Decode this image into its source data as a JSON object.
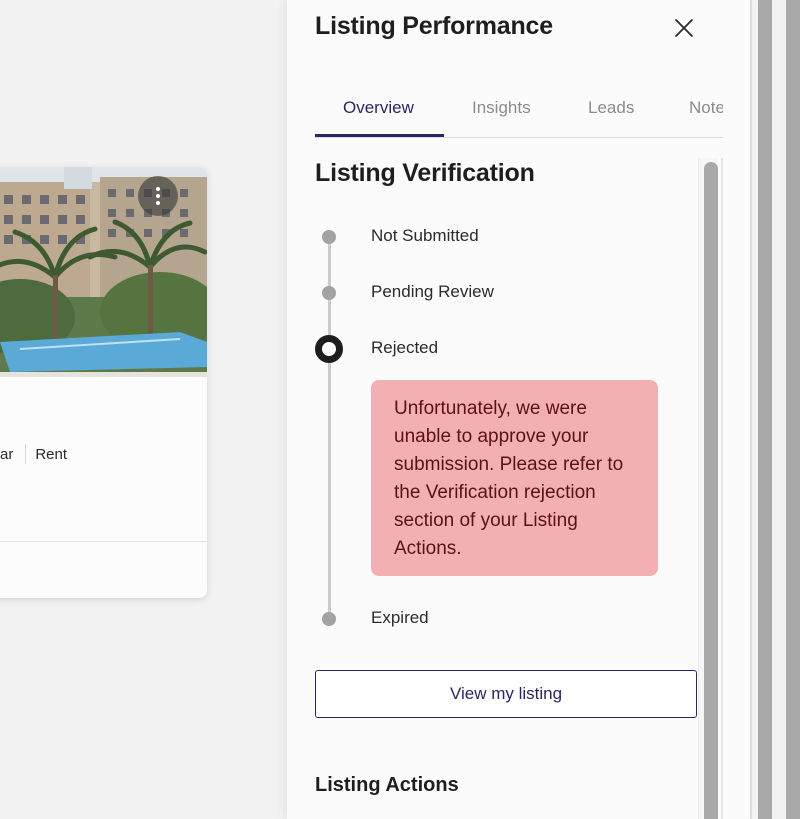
{
  "background_card": {
    "meta_tags": [
      "ar",
      "Rent"
    ]
  },
  "panel": {
    "title": "Listing Performance",
    "tabs": [
      {
        "label": "Overview",
        "active": true
      },
      {
        "label": "Insights",
        "active": false
      },
      {
        "label": "Leads",
        "active": false
      },
      {
        "label": "Note",
        "active": false
      }
    ]
  },
  "verification": {
    "title": "Listing Verification",
    "steps": [
      {
        "label": "Not Submitted",
        "state": "inactive"
      },
      {
        "label": "Pending Review",
        "state": "inactive"
      },
      {
        "label": "Rejected",
        "state": "current"
      },
      {
        "label": "Expired",
        "state": "inactive"
      }
    ],
    "rejection_message": "Unfortunately, we were unable to approve your submission. Please refer to the Verification rejection section of your Listing Actions.",
    "view_button_label": "View my listing"
  },
  "actions": {
    "title": "Listing Actions"
  },
  "colors": {
    "brand": "#2a2664",
    "rejection_bg": "#f3b0b3",
    "rejection_text": "#5a1118",
    "inactive_dot": "#a3a3a3",
    "scrollbar": "#a9a9a9"
  },
  "icons": {
    "close": "close-icon",
    "card_menu": "kebab-menu-icon"
  }
}
